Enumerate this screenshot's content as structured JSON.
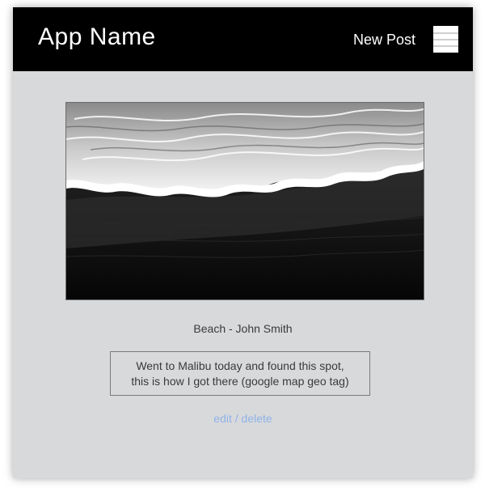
{
  "header": {
    "app_name": "App Name",
    "new_post_label": "New Post",
    "menu_icon": "hamburger-menu-icon"
  },
  "post": {
    "image_alt": "Black sand beach with white ocean waves",
    "caption": "Beach - John Smith",
    "description_line1": "Went to Malibu today and found this spot,",
    "description_line2": "this is how I got there (google map geo tag)",
    "edit_label": "edit",
    "separator": "/",
    "delete_label": "delete"
  },
  "colors": {
    "navbar": "#000000",
    "background": "#d8d9db",
    "link": "#8fb3e8"
  }
}
